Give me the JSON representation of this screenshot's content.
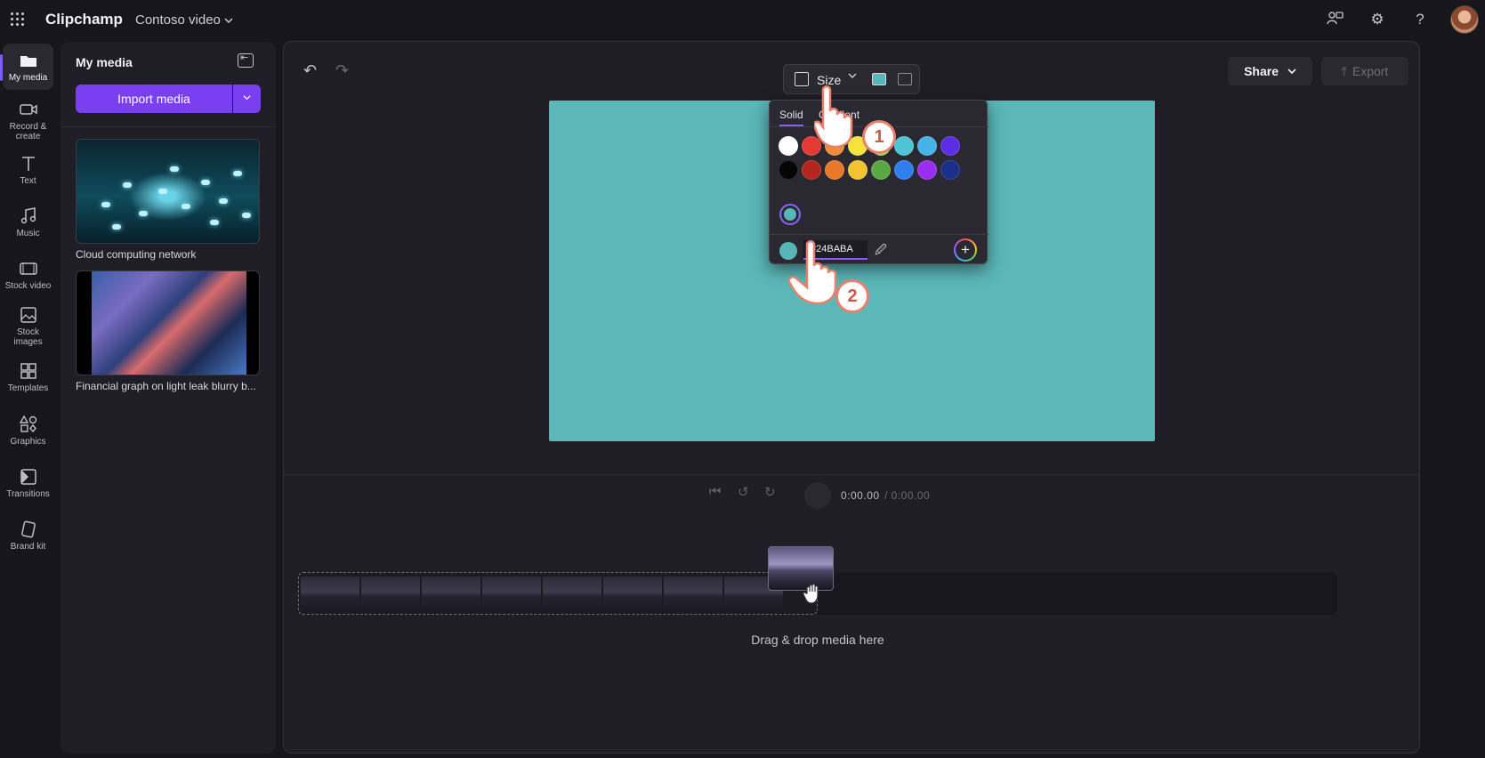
{
  "app": {
    "name": "Clipchamp",
    "project_title": "Contoso video"
  },
  "left_nav": [
    {
      "label": "My media",
      "active": true
    },
    {
      "label": "Record &\ncreate"
    },
    {
      "label": "Text"
    },
    {
      "label": "Music"
    },
    {
      "label": "Stock video"
    },
    {
      "label": "Stock\nimages"
    },
    {
      "label": "Templates"
    },
    {
      "label": "Graphics"
    },
    {
      "label": "Transitions"
    },
    {
      "label": "Brand kit"
    }
  ],
  "media_panel": {
    "title": "My media",
    "import_label": "Import media",
    "items": [
      {
        "label": "Cloud computing network"
      },
      {
        "label": "Financial graph on light leak blurry b..."
      }
    ]
  },
  "toolbar": {
    "size_label": "Size"
  },
  "header": {
    "share_label": "Share",
    "export_label": "Export"
  },
  "color_picker": {
    "tabs": [
      "Solid",
      "Gradient"
    ],
    "active_tab": "Solid",
    "swatches_row1": [
      "#ffffff",
      "#e53935",
      "#f08a3c",
      "#f5e23a",
      "#a8d84a",
      "#4fc3d8",
      "#46b2e8",
      "#5b2ee6"
    ],
    "swatches_row2": [
      "#050505",
      "#b3261e",
      "#e8782a",
      "#f2c230",
      "#5aa845",
      "#2f7ef0",
      "#9a2ef0",
      "#1a2e8a"
    ],
    "custom_color": "#57b7b8",
    "hex_value": "#24BABA"
  },
  "canvas": {
    "background": "#5bb7b8"
  },
  "playback": {
    "current_time": "0:00.00",
    "total_time": "/ 0:00.00"
  },
  "timeline": {
    "drop_hint": "Drag & drop media here"
  },
  "annotations": {
    "step1": "1",
    "step2": "2"
  }
}
